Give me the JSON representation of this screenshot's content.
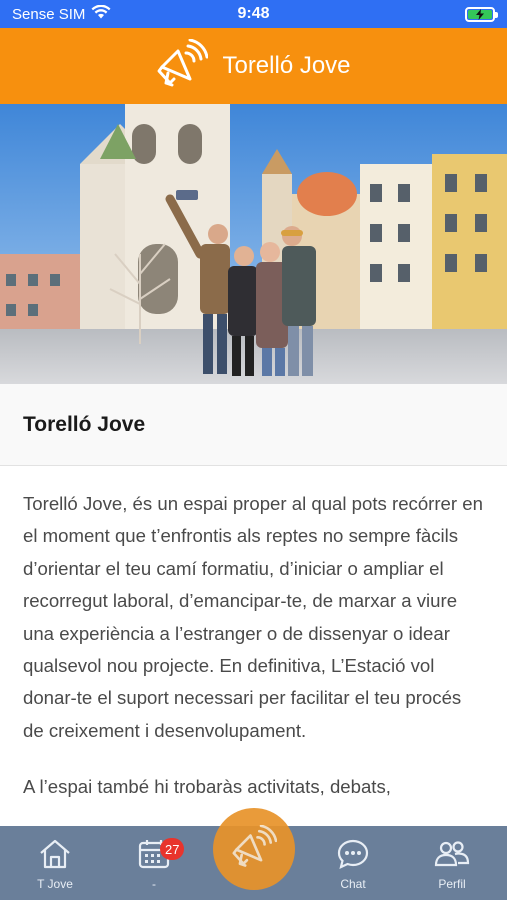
{
  "status_bar": {
    "carrier": "Sense SIM",
    "time": "9:48"
  },
  "header": {
    "title": "Torelló Jove",
    "icon": "megaphone-icon"
  },
  "section": {
    "title": "Torelló Jove"
  },
  "content": {
    "paragraphs": [
      "Torelló Jove, és un espai proper al qual pots recórrer en el moment que t’enfrontis als reptes no sempre fàcils d’orientar el teu camí formatiu, d’iniciar o ampliar el recorregut laboral, d’emancipar-te, de marxar a viure una experiència a l’estranger o de dissenyar o idear qualsevol nou projecte. En definitiva, L’Estació vol donar-te el suport necessari per facilitar el teu procés de creixement i desenvolupament.",
      "A l’espai també hi trobaràs activitats, debats,"
    ]
  },
  "tab_bar": {
    "tabs": [
      {
        "label": "T Jove",
        "icon": "home-icon"
      },
      {
        "label": "-",
        "icon": "calendar-icon",
        "badge": "27"
      },
      {
        "label": "Chat",
        "icon": "chat-icon"
      },
      {
        "label": "Perfil",
        "icon": "users-icon"
      }
    ],
    "center_icon": "megaphone-icon"
  },
  "colors": {
    "header": "#f7900e",
    "status_bar": "#2f6ff3",
    "tab_bar": "#6a7f9a",
    "badge": "#e8342c"
  }
}
